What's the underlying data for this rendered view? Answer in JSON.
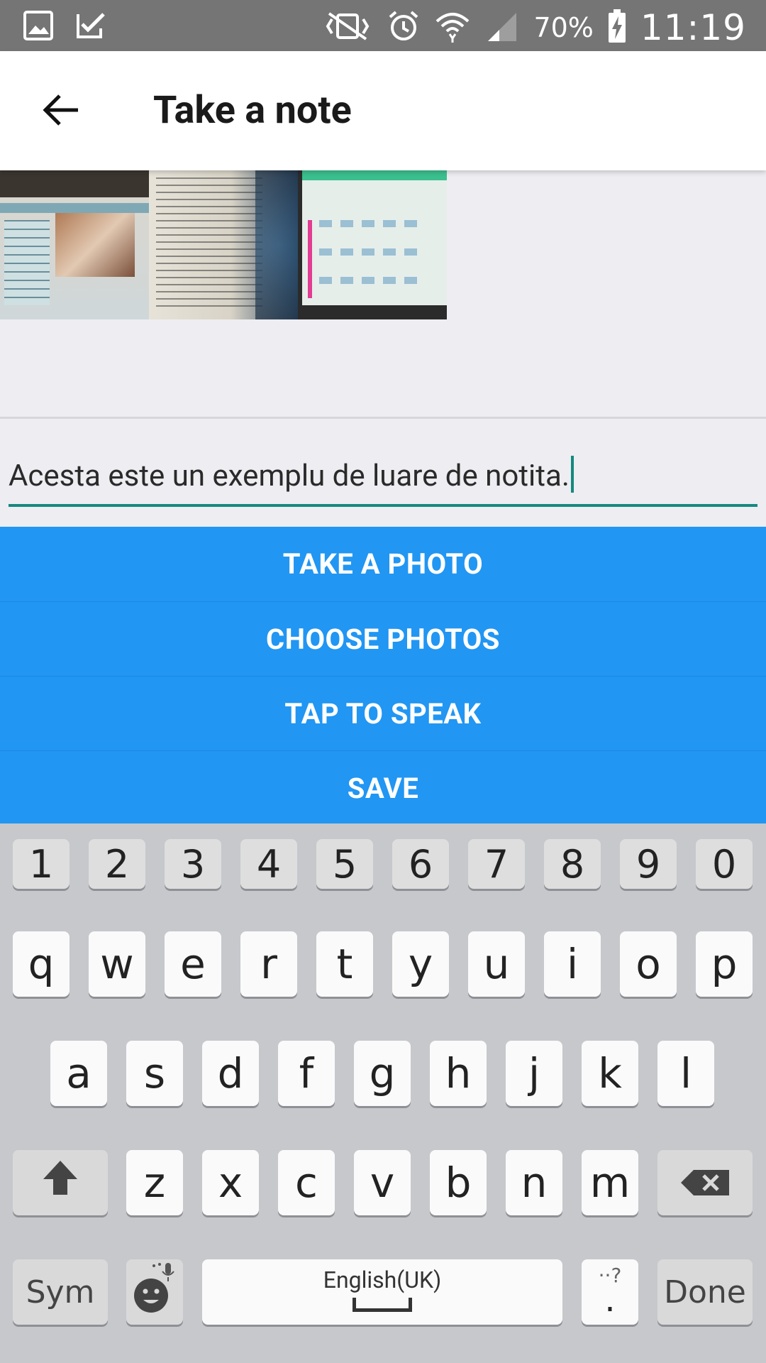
{
  "status_bar": {
    "battery": "70%",
    "time": "11:19",
    "icons": [
      "image-icon",
      "check-task-icon",
      "vibrate-icon",
      "alarm-icon",
      "wifi-icon",
      "signal-icon",
      "battery-charging-icon"
    ]
  },
  "app_bar": {
    "title": "Take a note",
    "back_icon": "arrow-back-icon"
  },
  "photos": [
    "photo-thumbnail-1",
    "photo-thumbnail-2",
    "photo-thumbnail-3"
  ],
  "note": {
    "value": "Acesta este un exemplu de luare de notita."
  },
  "actions": {
    "take_photo": "TAKE A PHOTO",
    "choose_photos": "CHOOSE PHOTOS",
    "tap_to_speak": "TAP TO SPEAK",
    "save": "SAVE"
  },
  "colors": {
    "accent": "#2196F3",
    "underline": "#14897E",
    "status_bar": "#757575"
  },
  "keyboard": {
    "number_row": [
      "1",
      "2",
      "3",
      "4",
      "5",
      "6",
      "7",
      "8",
      "9",
      "0"
    ],
    "row1": [
      "q",
      "w",
      "e",
      "r",
      "t",
      "y",
      "u",
      "i",
      "o",
      "p"
    ],
    "row2": [
      "a",
      "s",
      "d",
      "f",
      "g",
      "h",
      "j",
      "k",
      "l"
    ],
    "row3": [
      "z",
      "x",
      "c",
      "v",
      "b",
      "n",
      "m"
    ],
    "sym": "Sym",
    "space_language": "English(UK)",
    "period": ".",
    "done": "Done"
  }
}
